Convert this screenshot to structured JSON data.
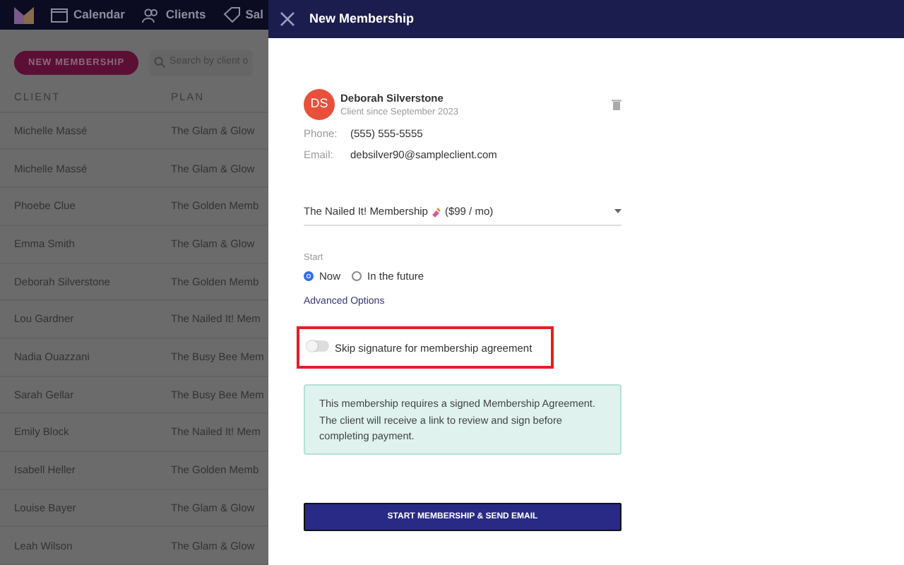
{
  "topnav": {
    "items": [
      {
        "label": "Calendar",
        "kind": "calendar"
      },
      {
        "label": "Clients",
        "kind": "clients"
      },
      {
        "label": "Sal",
        "kind": "tag"
      }
    ]
  },
  "toolbar": {
    "new_button": "NEW MEMBERSHIP",
    "search": {
      "placeholder": "Search by client o"
    }
  },
  "table": {
    "columns": [
      "CLIENT",
      "PLAN"
    ],
    "rows": [
      [
        "Michelle Massé",
        "The Glam & Glow"
      ],
      [
        "Michelle Massé",
        "The Glam & Glow"
      ],
      [
        "Phoebe Clue",
        "The Golden Memb"
      ],
      [
        "Emma Smith",
        "The Glam & Glow"
      ],
      [
        "Deborah Silverstone",
        "The Golden Memb"
      ],
      [
        "Lou Gardner",
        "The Nailed It! Mem"
      ],
      [
        "Nadia Ouazzani",
        "The Busy Bee Mem"
      ],
      [
        "Sarah Gellar",
        "The Busy Bee Mem"
      ],
      [
        "Emily Block",
        "The Nailed It! Mem"
      ],
      [
        "Isabell Heller",
        "The Golden Memb"
      ],
      [
        "Louise Bayer",
        "The Glam & Glow"
      ],
      [
        "Leah Wilson",
        "The Glam & Glow"
      ]
    ]
  },
  "drawer": {
    "title": "New Membership",
    "client": {
      "initials": "DS",
      "name": "Deborah Silverstone",
      "since": "Client since September 2023",
      "color": "#e9503b",
      "details": [
        {
          "label": "Phone:",
          "value": "(555) 555-5555"
        },
        {
          "label": "Email:",
          "value": "debsilver90@sampleclient.com"
        }
      ]
    },
    "plan_select": {
      "name": "The Nailed It! Membership",
      "price": "($99 / mo)"
    },
    "start": {
      "label": "Start",
      "options": [
        {
          "label": "Now",
          "selected": true
        },
        {
          "label": "In the future",
          "selected": false
        }
      ]
    },
    "advanced_link": "Advanced Options",
    "skip_signature": {
      "label": "Skip signature for membership agreement",
      "on": false,
      "highlighted": true
    },
    "notice": "This membership requires a signed Membership Agreement. The client will receive a link to review and sign before completing payment.",
    "submit_button": "START MEMBERSHIP & SEND EMAIL"
  }
}
